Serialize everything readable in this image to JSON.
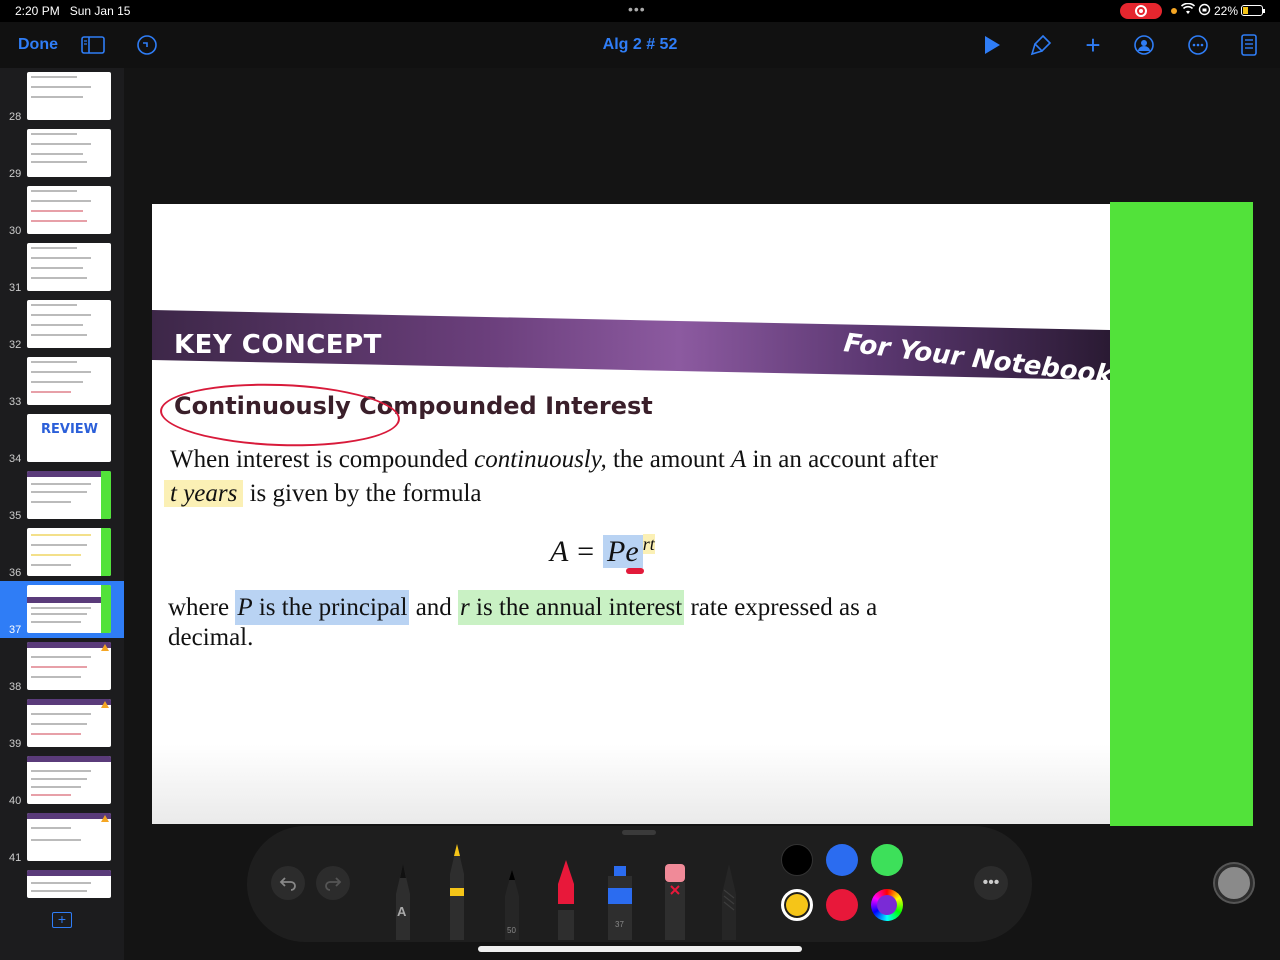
{
  "status": {
    "time": "2:20 PM",
    "date": "Sun Jan 15",
    "battery": "22%"
  },
  "toolbar": {
    "done_label": "Done",
    "title": "Alg 2 # 52",
    "accent": "#2f7df6"
  },
  "sidebar": {
    "selected": "37",
    "pages": [
      {
        "num": "28"
      },
      {
        "num": "29"
      },
      {
        "num": "30"
      },
      {
        "num": "31"
      },
      {
        "num": "32"
      },
      {
        "num": "33"
      },
      {
        "num": "34",
        "thumb_text": "REVIEW"
      },
      {
        "num": "35"
      },
      {
        "num": "36"
      },
      {
        "num": "37"
      },
      {
        "num": "38"
      },
      {
        "num": "39"
      },
      {
        "num": "40"
      },
      {
        "num": "41"
      }
    ]
  },
  "page": {
    "banner_title": "KEY CONCEPT",
    "banner_right": "For Your Notebook",
    "concept_title": "Continuously Compounded Interest",
    "line1_a": "When interest is compounded ",
    "line1_b": "continuously,",
    "line1_c": " the amount ",
    "line1_d": "A",
    "line1_e": " in an account after",
    "line2_a": "t years",
    "line2_b": " is given by the formula",
    "formula_lhs": "A = ",
    "formula_P": "P",
    "formula_e": "e",
    "formula_exp": "rt",
    "line3_a": "where ",
    "line3_b": "P is the principal",
    "line3_c": " and ",
    "line3_d": "r is the annual interest",
    "line3_e": " rate expressed as a",
    "line4": "decimal.",
    "highlight_colors": {
      "yellow": "#fbf0b5",
      "blue": "#b9d3f3",
      "green": "#c9f1c4",
      "side_panel": "#52e23a"
    }
  },
  "drawing_tools": {
    "pen_label": "A",
    "pencil_size": "50",
    "marker_size": "37",
    "colors": [
      "#000000",
      "#2b6cf0",
      "#3de05a",
      "#f5c518",
      "#e8183a",
      "multicolor"
    ],
    "selected_color": "#f5c518"
  }
}
